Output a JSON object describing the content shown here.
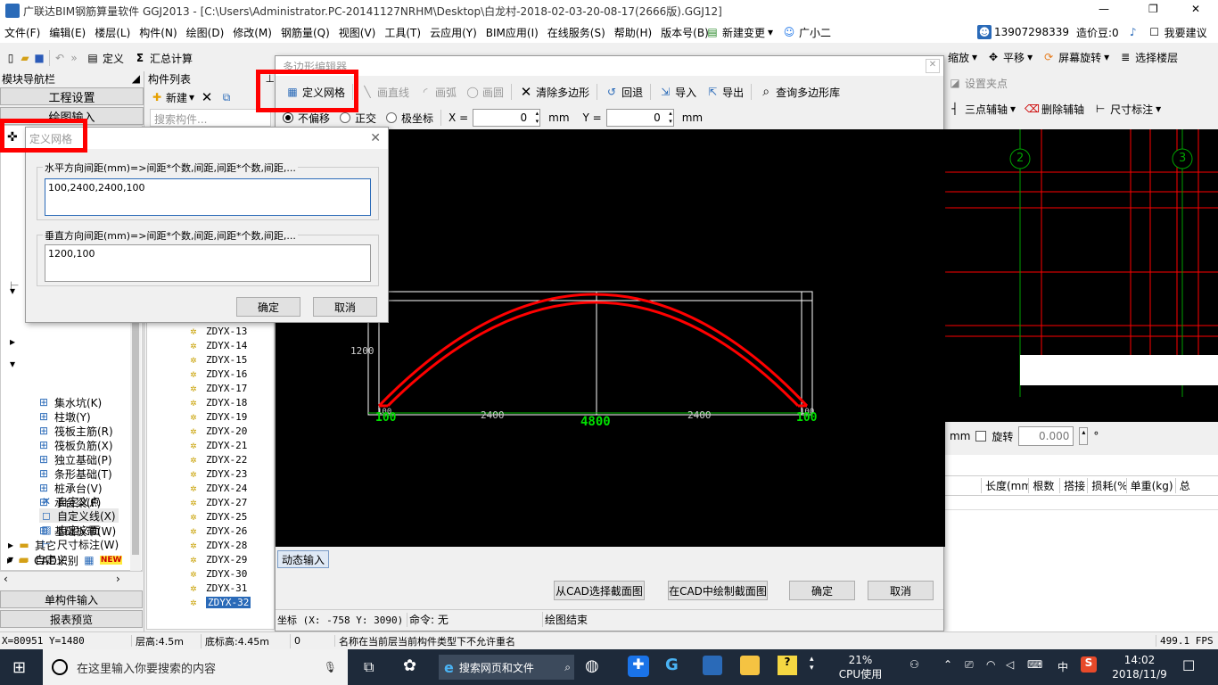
{
  "titlebar": {
    "text": "广联达BIM钢筋算量软件 GGJ2013 - [C:\\Users\\Administrator.PC-20141127NRHM\\Desktop\\白龙村-2018-02-03-20-08-17(2666版).GGJ12]",
    "min": "—",
    "max": "❐",
    "close": "✕"
  },
  "menu": [
    "文件(F)",
    "编辑(E)",
    "楼层(L)",
    "构件(N)",
    "绘图(D)",
    "修改(M)",
    "钢筋量(Q)",
    "视图(V)",
    "工具(T)",
    "云应用(Y)",
    "BIM应用(I)",
    "在线服务(S)",
    "帮助(H)",
    "版本号(B)"
  ],
  "menu_right": {
    "new_change": "新建变更",
    "assistant": "广小二",
    "phone": "13907298339",
    "price": "造价豆:0",
    "suggest": "我要建议"
  },
  "toolbar_left": {
    "define": "定义",
    "sum": "汇总计算"
  },
  "toolbar_right_1": {
    "zoom": "缩放",
    "pan": "平移",
    "rotate": "屏幕旋转",
    "floor": "选择楼层"
  },
  "toolbar_right_2": {
    "setpoint": "设置夹点"
  },
  "toolbar_right_3": {
    "three_pt": "三点辅轴",
    "del_aux": "删除辅轴",
    "dim": "尺寸标注"
  },
  "left_panel": {
    "title": "模块导航栏",
    "project_settings": "工程设置",
    "drawing_input": "绘图输入",
    "tree": [
      "集水坑(K)",
      "柱墩(Y)",
      "筏板主筋(R)",
      "筏板负筋(X)",
      "独立基础(P)",
      "条形基础(T)",
      "桩承台(V)",
      "承台梁(F)",
      "桩(U)",
      "基础板带(W)"
    ],
    "other": "其它",
    "custom": "自定义",
    "custom_items": [
      "自定义点",
      "自定义线(X)",
      "自定义面",
      "尺寸标注(W)"
    ],
    "cad": "CAD识别",
    "new_badge": "NEW",
    "single_input": "单构件输入",
    "report": "报表预览"
  },
  "comp_list": {
    "title": "构件列表",
    "new": "新建",
    "search_placeholder": "搜索构件...",
    "items": [
      "ZDYX-13",
      "ZDYX-14",
      "ZDYX-15",
      "ZDYX-16",
      "ZDYX-17",
      "ZDYX-18",
      "ZDYX-19",
      "ZDYX-20",
      "ZDYX-21",
      "ZDYX-22",
      "ZDYX-23",
      "ZDYX-24",
      "ZDYX-27",
      "ZDYX-25",
      "ZDYX-26",
      "ZDYX-28",
      "ZDYX-29",
      "ZDYX-30",
      "ZDYX-31",
      "ZDYX-32"
    ]
  },
  "poly_editor": {
    "title": "多边形编辑器",
    "define_grid": "定义网格",
    "draw_line": "画直线",
    "draw_arc": "画弧",
    "draw_circle": "画圆",
    "clear": "清除多边形",
    "undo": "回退",
    "import": "导入",
    "export": "导出",
    "query": "查询多边形库",
    "no_offset": "不偏移",
    "ortho": "正交",
    "polar": "极坐标",
    "x_label": "X =",
    "x_value": "0",
    "y_label": "Y =",
    "y_value": "0",
    "unit": "mm",
    "dim_left": "100",
    "dim_right": "100",
    "dim_mid_left": "2400",
    "dim_mid_right": "2400",
    "dim_total": "4800",
    "dim_height": "1200",
    "small_100a": "100",
    "small_100b": "100",
    "dynamic_input": "动态输入",
    "from_cad": "从CAD选择截面图",
    "draw_in_cad": "在CAD中绘制截面图",
    "ok": "确定",
    "cancel": "取消",
    "coord": "坐标 (X: -758 Y: 3090)",
    "command": "命令: 无",
    "status": "绘图结束"
  },
  "grid_dialog": {
    "title": "定义网格",
    "h_label": "水平方向间距(mm)=>间距*个数,间距,间距*个数,间距,...",
    "h_value": "100,2400,2400,100",
    "v_label": "垂直方向间距(mm)=>间距*个数,间距,间距*个数,间距,...",
    "v_value": "1200,100",
    "ok": "确定",
    "cancel": "取消"
  },
  "right_view": {
    "axis2": "2",
    "axis3": "3",
    "mm": "mm",
    "rotate": "旋转",
    "rotate_value": "0.000",
    "deg": "°"
  },
  "table_headers": [
    "长度(mm)",
    "根数",
    "搭接",
    "损耗(%)",
    "单重(kg)",
    "总"
  ],
  "statusbar": {
    "coord": "X=80951 Y=1480",
    "floor_h": "层高:4.5m",
    "base_h": "底标高:4.45m",
    "zero": "0",
    "msg": "名称在当前层当前构件类型下不允许重名",
    "fps": "499.1 FPS"
  },
  "taskbar": {
    "search": "在这里输入你要搜索的内容",
    "browser_search": "搜索网页和文件",
    "cpu_pct": "21%",
    "cpu_label": "CPU使用",
    "ime": "中",
    "time": "14:02",
    "date": "2018/11/9"
  },
  "colors": {
    "red": "#ff0000",
    "green": "#00dd00",
    "accent": "#0078d7"
  }
}
